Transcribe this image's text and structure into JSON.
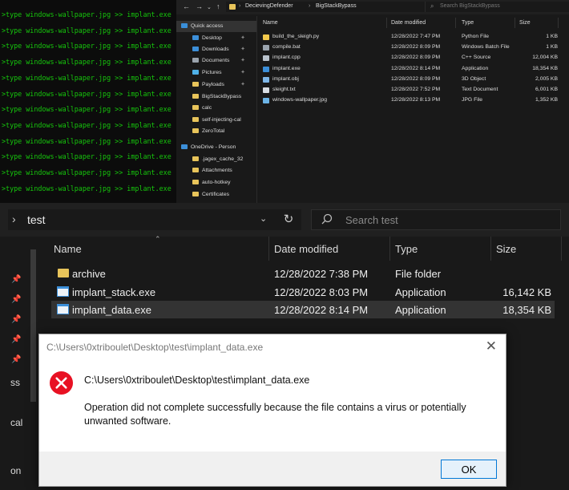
{
  "terminal": {
    "command": ">type windows-wallpaper.jpg >> implant.exe",
    "line_count": 12
  },
  "top_explorer": {
    "breadcrumb": [
      "DecievingDefender",
      "BigStackBypass"
    ],
    "search_placeholder": "Search BigStackBypass",
    "columns": {
      "name": "Name",
      "date": "Date modified",
      "type": "Type",
      "size": "Size"
    },
    "nav": [
      {
        "label": "Quick access",
        "icon": "star-icon",
        "color": "#3a8fd9",
        "active": true,
        "pinned": false
      },
      {
        "label": "Desktop",
        "icon": "desktop-icon",
        "color": "#3c8fd9",
        "active": false,
        "pinned": true
      },
      {
        "label": "Downloads",
        "icon": "download-icon",
        "color": "#3c8fd9",
        "active": false,
        "pinned": true
      },
      {
        "label": "Documents",
        "icon": "documents-icon",
        "color": "#9aa3ad",
        "active": false,
        "pinned": true
      },
      {
        "label": "Pictures",
        "icon": "pictures-icon",
        "color": "#4fb1e8",
        "active": false,
        "pinned": true
      },
      {
        "label": "Payloads",
        "icon": "folder-icon",
        "color": "#e8c45a",
        "active": false,
        "pinned": true
      },
      {
        "label": "BigStackBypass",
        "icon": "folder-icon",
        "color": "#e8c45a",
        "active": false,
        "pinned": false
      },
      {
        "label": "calc",
        "icon": "folder-icon",
        "color": "#e8c45a",
        "active": false,
        "pinned": false
      },
      {
        "label": "self-injecting-cal",
        "icon": "folder-icon",
        "color": "#e8c45a",
        "active": false,
        "pinned": false
      },
      {
        "label": "ZeroTotal",
        "icon": "folder-icon",
        "color": "#e8c45a",
        "active": false,
        "pinned": false
      },
      {
        "label": "OneDrive - Person",
        "icon": "cloud-icon",
        "color": "#3c8fd9",
        "active": false,
        "pinned": false
      },
      {
        "label": ".jagex_cache_32",
        "icon": "folder-icon",
        "color": "#e8c45a",
        "active": false,
        "pinned": false
      },
      {
        "label": "Attachments",
        "icon": "folder-icon",
        "color": "#e8c45a",
        "active": false,
        "pinned": false
      },
      {
        "label": "auto-hotkey",
        "icon": "folder-icon",
        "color": "#e8c45a",
        "active": false,
        "pinned": false
      },
      {
        "label": "Certificates",
        "icon": "folder-icon",
        "color": "#e8c45a",
        "active": false,
        "pinned": false
      }
    ],
    "files": [
      {
        "name": "build_the_sleigh.py",
        "date": "12/28/2022 7:47 PM",
        "type": "Python File",
        "size": "1 KB",
        "icon": "python-file-icon",
        "color": "#f2c94c"
      },
      {
        "name": "compile.bat",
        "date": "12/28/2022 8:09 PM",
        "type": "Windows Batch File",
        "size": "1 KB",
        "icon": "batch-file-icon",
        "color": "#9aa3ad"
      },
      {
        "name": "implant.cpp",
        "date": "12/28/2022 8:09 PM",
        "type": "C++ Source",
        "size": "12,004 KB",
        "icon": "cpp-file-icon",
        "color": "#b9c2cc"
      },
      {
        "name": "implant.exe",
        "date": "12/28/2022 8:14 PM",
        "type": "Application",
        "size": "18,354 KB",
        "icon": "application-icon",
        "color": "#3c8fd9"
      },
      {
        "name": "implant.obj",
        "date": "12/28/2022 8:09 PM",
        "type": "3D Object",
        "size": "2,005 KB",
        "icon": "3d-object-icon",
        "color": "#7fb7e8"
      },
      {
        "name": "sleight.txt",
        "date": "12/28/2022 7:52 PM",
        "type": "Text Document",
        "size": "6,001 KB",
        "icon": "text-file-icon",
        "color": "#d8dde2"
      },
      {
        "name": "windows-wallpaper.jpg",
        "date": "12/28/2022 8:13 PM",
        "type": "JPG File",
        "size": "1,352 KB",
        "icon": "image-file-icon",
        "color": "#6cb4e6"
      }
    ]
  },
  "bottom_explorer": {
    "path": "test",
    "search_placeholder": "Search test",
    "columns": {
      "name": "Name",
      "date": "Date modified",
      "type": "Type",
      "size": "Size"
    },
    "side_labels": [
      "ss",
      "cal",
      "on"
    ],
    "files": [
      {
        "name": "archive",
        "date": "12/28/2022 7:38 PM",
        "type": "File folder",
        "size": "",
        "icon": "folder-icon",
        "color": "#e8c45a",
        "selected": false
      },
      {
        "name": "implant_stack.exe",
        "date": "12/28/2022 8:03 PM",
        "type": "Application",
        "size": "16,142 KB",
        "icon": "application-icon",
        "color": "#3c8fd9",
        "selected": false
      },
      {
        "name": "implant_data.exe",
        "date": "12/28/2022 8:14 PM",
        "type": "Application",
        "size": "18,354 KB",
        "icon": "application-icon",
        "color": "#3c8fd9",
        "selected": true
      }
    ]
  },
  "dialog": {
    "title": "C:\\Users\\0xtriboulet\\Desktop\\test\\implant_data.exe",
    "path": "C:\\Users\\0xtriboulet\\Desktop\\test\\implant_data.exe",
    "message": "Operation did not complete successfully because the file contains a virus or potentially unwanted software.",
    "ok_label": "OK",
    "error_color": "#e81123"
  }
}
